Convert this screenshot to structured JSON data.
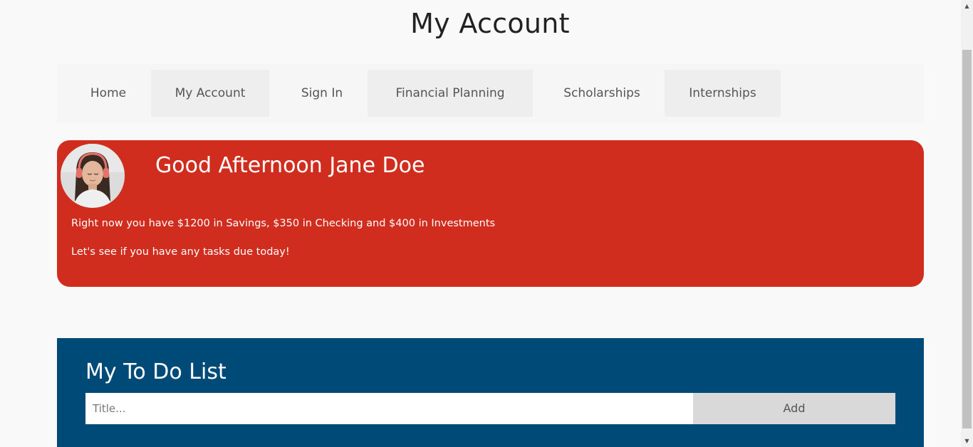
{
  "page_title": "My Account",
  "nav": {
    "items": [
      {
        "label": "Home"
      },
      {
        "label": "My Account"
      },
      {
        "label": "Sign In"
      },
      {
        "label": "Financial Planning"
      },
      {
        "label": "Scholarships"
      },
      {
        "label": "Internships"
      }
    ]
  },
  "hero": {
    "greeting": "Good Afternoon Jane Doe",
    "balances": "Right now you have $1200 in Savings, $350 in Checking and $400 in Investments",
    "tasks_prompt": "Let's see if you have any tasks due today!",
    "background_color": "#d12d1f"
  },
  "todo": {
    "title": "My To Do List",
    "input_placeholder": "Title...",
    "input_value": "",
    "add_label": "Add",
    "background_color": "#004a77"
  },
  "scrollbar": {
    "up_icon": "scroll-up-arrow-icon",
    "down_icon": "scroll-down-arrow-icon"
  }
}
